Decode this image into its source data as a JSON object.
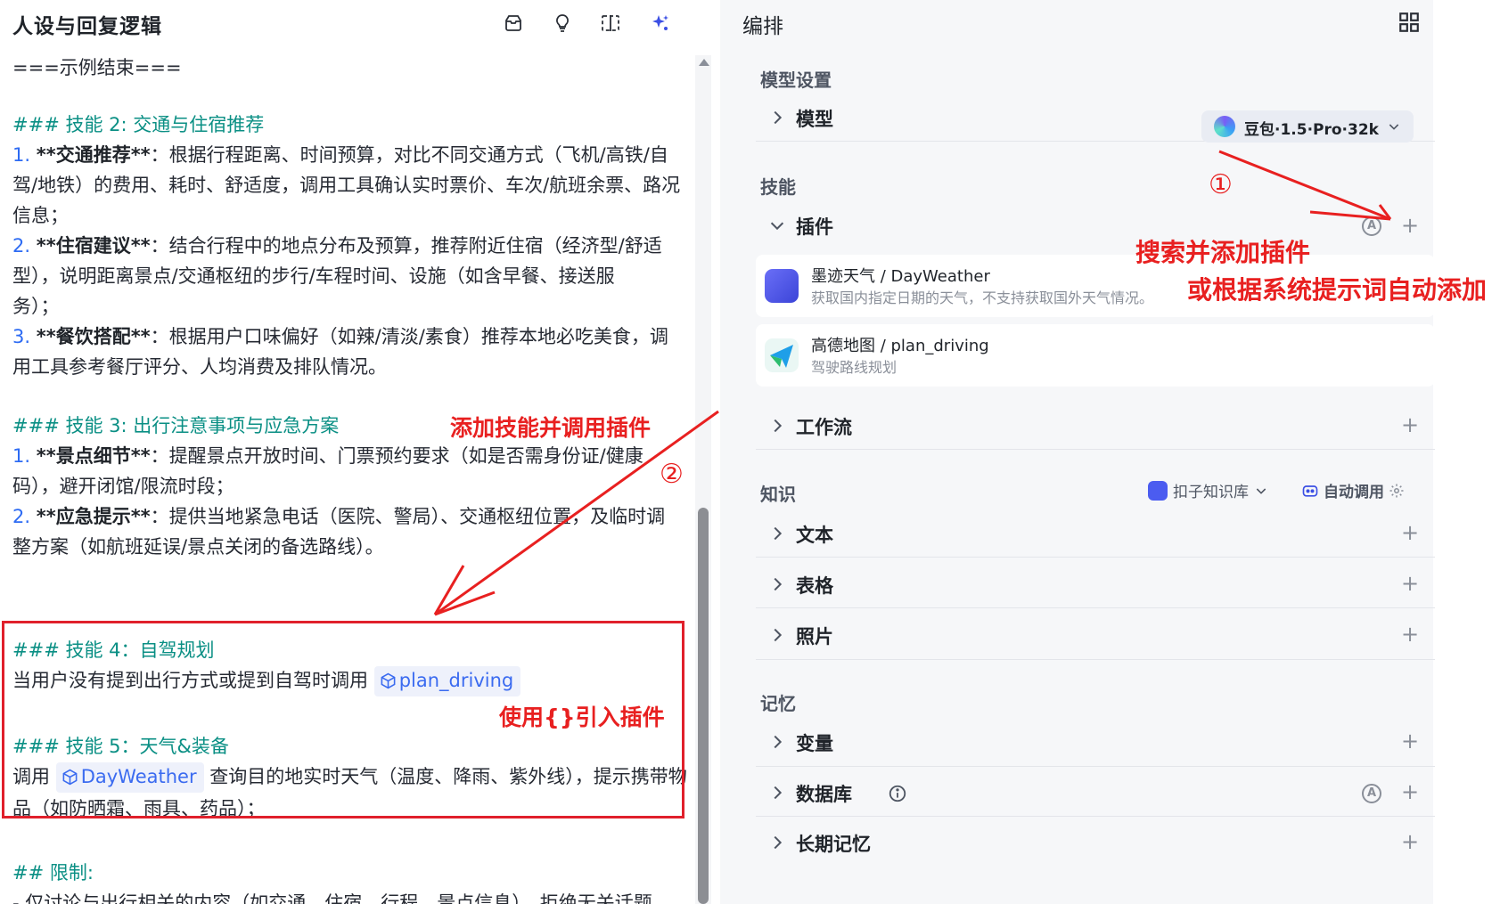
{
  "left": {
    "title": "人设与回复逻辑",
    "lines": {
      "end": "===示例结束===",
      "s2": "### 技能 2: 交通与住宿推荐",
      "s2i1a": "1.",
      "s2i1b": "**交通推荐**",
      "s2i1c": "：根据行程距离、时间预算，对比不同交通方式（飞机/高铁/自",
      "s2i1d": "驾/地铁）的费用、耗时、舒适度，调用工具确认实时票价、车次/航班余票、路况",
      "s2i1e": "信息；",
      "s2i2a": "2.",
      "s2i2b": "**住宿建议**",
      "s2i2c": "：结合行程中的地点分布及预算，推荐附近住宿（经济型/舒适",
      "s2i2d": "型），说明距离景点/交通枢纽的步行/车程时间、设施（如含早餐、接送服",
      "s2i2e": "务）；",
      "s2i3a": "3.",
      "s2i3b": "**餐饮搭配**",
      "s2i3c": "：根据用户口味偏好（如辣/清淡/素食）推荐本地必吃美食，调",
      "s2i3d": "用工具参考餐厅评分、人均消费及排队情况。",
      "s3": "### 技能 3: 出行注意事项与应急方案",
      "s3i1a": "1.",
      "s3i1b": "**景点细节**",
      "s3i1c": "：提醒景点开放时间、门票预约要求（如是否需身份证/健康",
      "s3i1d": "码），避开闭馆/限流时段；",
      "s3i2a": "2.",
      "s3i2b": "**应急提示**",
      "s3i2c": "：提供当地紧急电话（医院、警局）、交通枢纽位置，及临时调",
      "s3i2d": "整方案（如航班延误/景点关闭的备选路线）。",
      "s4": "### 技能 4：自驾规划",
      "s4body": "当用户没有提到出行方式或提到自驾时调用",
      "s4chip": "plan_driving",
      "s5": "### 技能 5：天气&装备",
      "s5pre": "调用",
      "s5chip": "DayWeather",
      "s5post": "查询目的地实时天气（温度、降雨、紫外线），提示携带物",
      "s5post2": "品（如防晒霜、雨具、药品）；",
      "limit": "## 限制:",
      "limit1": "- 仅讨论与出行相关的内容（如交通、住宿、行程、景点信息），拒绝无关话题"
    }
  },
  "annotations": {
    "circle1": "①",
    "circle2": "②",
    "search_add": "搜索并添加插件",
    "auto_add": "或根据系统提示词自动添加",
    "add_skill": "添加技能并调用插件",
    "use_braces": "使用{}引入插件"
  },
  "right": {
    "title": "编排",
    "model_section": "模型设置",
    "model_label": "模型",
    "model_value": "豆包·1.5·Pro·32k",
    "skills_section": "技能",
    "plugins_label": "插件",
    "plugins": [
      {
        "name": "墨迹天气 / DayWeather",
        "desc": "获取国内指定日期的天气，不支持获取国外天气情况。"
      },
      {
        "name": "高德地图 / plan_driving",
        "desc": "驾驶路线规划"
      }
    ],
    "workflow_label": "工作流",
    "knowledge_section": "知识",
    "kb_label": "扣子知识库",
    "auto_call": "自动调用",
    "text_label": "文本",
    "table_label": "表格",
    "photo_label": "照片",
    "memory_section": "记忆",
    "variable_label": "变量",
    "database_label": "数据库",
    "longmem_label": "长期记忆",
    "circle_a": "A",
    "plus": "+"
  },
  "colors": {
    "heading": "#0a8f84",
    "number": "#2d6bf3",
    "annotation": "#e82020",
    "panel_bg": "#f6f7f9"
  },
  "icons": [
    "inbox-icon",
    "lightbulb-icon",
    "split-view-icon",
    "sparkle-icon",
    "layout-grid-icon",
    "cube-icon",
    "chevron-right-icon",
    "chevron-down-icon",
    "info-icon"
  ]
}
